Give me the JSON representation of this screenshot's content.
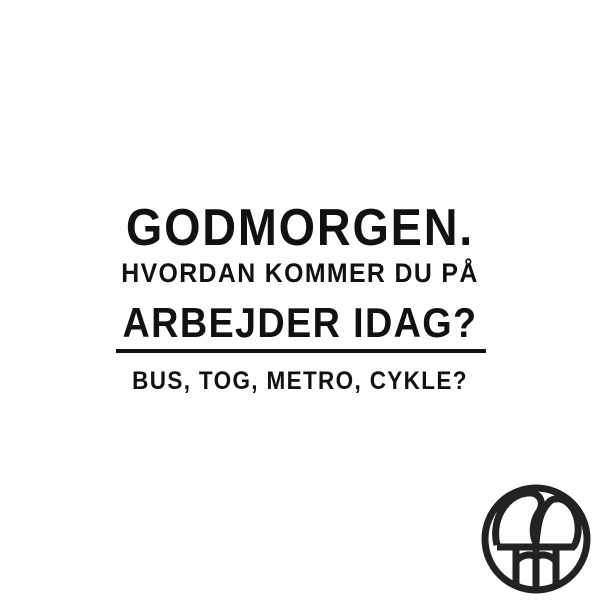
{
  "text": {
    "headline": "GODMORGEN.",
    "line2": "HVORDAN KOMMER DU PÅ",
    "line3": "ARBEJDER IDAG?",
    "line4": "BUS, TOG, METRO, CYKLE?"
  },
  "colors": {
    "background": "#ffffff",
    "text": "#111111"
  },
  "logo": {
    "icon": "circular-brand-logo"
  }
}
